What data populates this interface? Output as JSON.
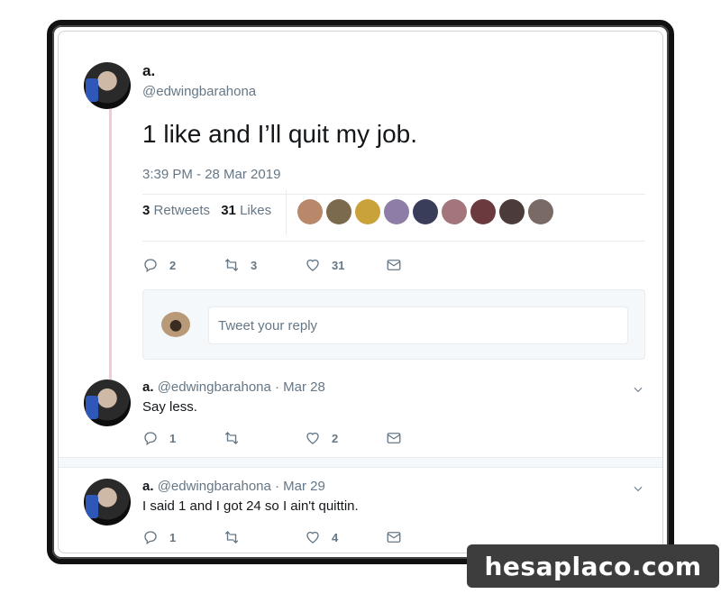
{
  "main_tweet": {
    "display_name": "a.",
    "handle": "@edwingbarahona",
    "text": "1 like and I’ll quit my job.",
    "timestamp": "3:39 PM - 28 Mar 2019",
    "retweets_count": "3",
    "retweets_label": "Retweets",
    "likes_count": "31",
    "likes_label": "Likes",
    "actions": {
      "replies": "2",
      "retweets": "3",
      "likes": "31"
    }
  },
  "reply_composer": {
    "placeholder": "Tweet your reply"
  },
  "replies": [
    {
      "display_name": "a.",
      "handle": "@edwingbarahona",
      "date": "· Mar 28",
      "text": "Say less.",
      "actions": {
        "replies": "1",
        "retweets": "",
        "likes": "2"
      }
    },
    {
      "display_name": "a.",
      "handle": "@edwingbarahona",
      "date": "· Mar 29",
      "text": "I said 1 and I got 24 so I ain't quittin.",
      "actions": {
        "replies": "1",
        "retweets": "",
        "likes": "4"
      }
    }
  ],
  "liker_colors": [
    "#b9876a",
    "#7c6a4f",
    "#c9a23a",
    "#8e7da6",
    "#3a3d5a",
    "#a2767a",
    "#6b3a3e",
    "#4b3b3b",
    "#7a6a66"
  ],
  "watermark": "hesaplaco.com",
  "icons": [
    "reply-icon",
    "retweet-icon",
    "like-icon",
    "dm-icon",
    "chevron-down-icon"
  ]
}
